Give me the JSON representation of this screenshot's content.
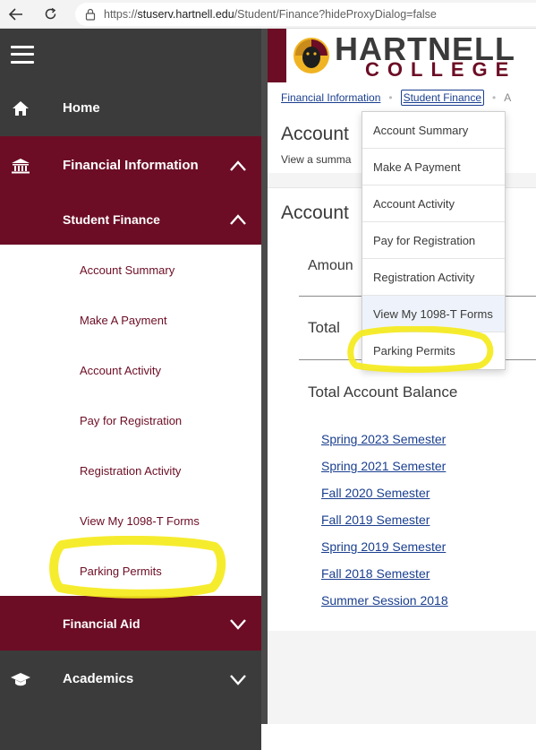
{
  "browser": {
    "url_prefix": "https://",
    "url_host": "stuserv.hartnell.edu",
    "url_path": "/Student/Finance?hideProxyDialog=false",
    "back_icon": "arrow-left-icon",
    "reload_icon": "reload-icon"
  },
  "sidebar": {
    "menu_icon": "hamburger-icon",
    "home_label": "Home",
    "financial_info_label": "Financial Information",
    "student_finance_label": "Student Finance",
    "sub_items": [
      {
        "label": "Account Summary"
      },
      {
        "label": "Make A Payment"
      },
      {
        "label": "Account Activity"
      },
      {
        "label": "Pay for Registration"
      },
      {
        "label": "Registration Activity"
      },
      {
        "label": "View My 1098-T Forms"
      },
      {
        "label": "Parking Permits"
      }
    ],
    "financial_aid_label": "Financial Aid",
    "academics_label": "Academics"
  },
  "banner": {
    "logo_line1": "HARTNELL",
    "logo_line2": "COLLEGE"
  },
  "breadcrumbs": {
    "item1": "Financial Information",
    "item2": "Student Finance",
    "item3": "A"
  },
  "page": {
    "title": "Account",
    "subtitle": "View a summa"
  },
  "card": {
    "title": "Account",
    "amount_label": "Amoun",
    "total_label": "Total",
    "balance_label": "Total Account Balance",
    "terms": [
      "Spring 2023 Semester",
      "Spring 2021 Semester",
      "Fall 2020 Semester",
      "Fall 2019 Semester",
      "Spring 2019 Semester",
      "Fall 2018 Semester",
      "Summer Session 2018"
    ]
  },
  "dropdown": {
    "items": [
      "Account Summary",
      "Make A Payment",
      "Account Activity",
      "Pay for Registration",
      "Registration Activity",
      "View My 1098-T Forms",
      "Parking Permits"
    ]
  },
  "colors": {
    "brand_maroon": "#6c0d25",
    "sidebar_dark": "#3b3b3b",
    "link_blue": "#1a3f8f",
    "highlighter": "#f5ea1c"
  }
}
